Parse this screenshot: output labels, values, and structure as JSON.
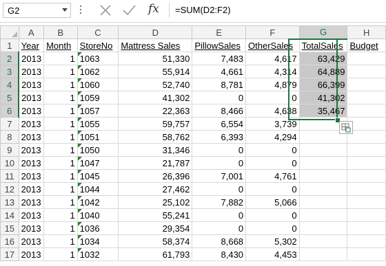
{
  "formula_bar": {
    "name_box": "G2",
    "fx_label": "fx",
    "formula": "=SUM(D2:F2)"
  },
  "column_headers": [
    "A",
    "B",
    "C",
    "D",
    "E",
    "F",
    "G",
    "H"
  ],
  "header_row": [
    "Year",
    "Month",
    "StoreNo",
    "Mattress  Sales",
    "PillowSales",
    "OtherSales",
    "TotalSales",
    "Budget"
  ],
  "rows": [
    {
      "n": "2",
      "cells": [
        "2013",
        "1",
        "1063",
        "51,330",
        "7,483",
        "4,617",
        "63,429",
        ""
      ]
    },
    {
      "n": "3",
      "cells": [
        "2013",
        "1",
        "1062",
        "55,914",
        "4,661",
        "4,314",
        "64,889",
        ""
      ]
    },
    {
      "n": "4",
      "cells": [
        "2013",
        "1",
        "1060",
        "52,740",
        "8,781",
        "4,879",
        "66,399",
        ""
      ]
    },
    {
      "n": "5",
      "cells": [
        "2013",
        "1",
        "1059",
        "41,302",
        "0",
        "0",
        "41,302",
        ""
      ]
    },
    {
      "n": "6",
      "cells": [
        "2013",
        "1",
        "1057",
        "22,363",
        "8,466",
        "4,638",
        "35,467",
        ""
      ]
    },
    {
      "n": "7",
      "cells": [
        "2013",
        "1",
        "1055",
        "59,757",
        "6,554",
        "3,739",
        "",
        ""
      ]
    },
    {
      "n": "8",
      "cells": [
        "2013",
        "1",
        "1051",
        "58,762",
        "6,393",
        "4,294",
        "",
        ""
      ]
    },
    {
      "n": "9",
      "cells": [
        "2013",
        "1",
        "1050",
        "31,346",
        "0",
        "0",
        "",
        ""
      ]
    },
    {
      "n": "10",
      "cells": [
        "2013",
        "1",
        "1047",
        "21,787",
        "0",
        "0",
        "",
        ""
      ]
    },
    {
      "n": "11",
      "cells": [
        "2013",
        "1",
        "1045",
        "26,396",
        "7,001",
        "4,761",
        "",
        ""
      ]
    },
    {
      "n": "12",
      "cells": [
        "2013",
        "1",
        "1044",
        "27,462",
        "0",
        "0",
        "",
        ""
      ]
    },
    {
      "n": "13",
      "cells": [
        "2013",
        "1",
        "1042",
        "25,102",
        "7,882",
        "5,066",
        "",
        ""
      ]
    },
    {
      "n": "14",
      "cells": [
        "2013",
        "1",
        "1040",
        "55,241",
        "0",
        "0",
        "",
        ""
      ]
    },
    {
      "n": "15",
      "cells": [
        "2013",
        "1",
        "1036",
        "29,354",
        "0",
        "0",
        "",
        ""
      ]
    },
    {
      "n": "16",
      "cells": [
        "2013",
        "1",
        "1034",
        "58,374",
        "8,668",
        "5,302",
        "",
        ""
      ]
    },
    {
      "n": "17",
      "cells": [
        "2013",
        "1",
        "1032",
        "61,793",
        "8,430",
        "4,453",
        "",
        ""
      ]
    }
  ],
  "selected_column": "G",
  "selected_rows": [
    "2",
    "3",
    "4",
    "5",
    "6"
  ],
  "colors": {
    "accent": "#217346",
    "selection_fill": "#c9c9c9",
    "grid_line": "#d9d9d9",
    "header_bg": "#f3f3f3",
    "error_triangle": "#2f7d32"
  }
}
